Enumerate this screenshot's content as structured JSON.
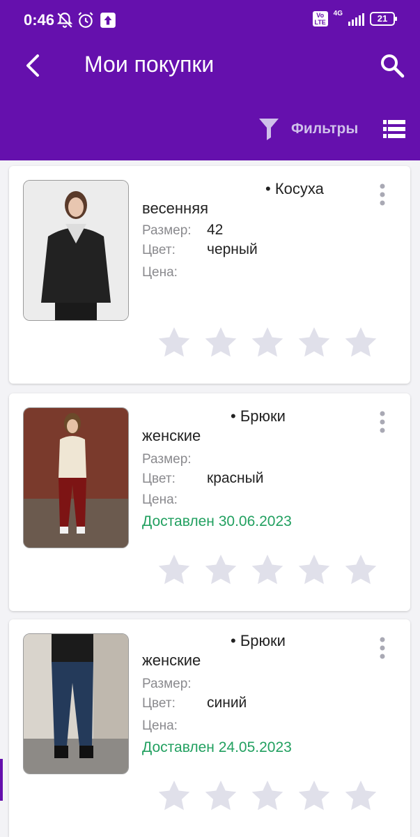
{
  "status_bar": {
    "time": "0:46",
    "network": "4G",
    "volte": "Vo LTE",
    "battery": "21"
  },
  "header": {
    "title": "Мои покупки",
    "filter_label": "Фильтры"
  },
  "labels": {
    "size": "Размер:",
    "color": "Цвет:",
    "price": "Цена:"
  },
  "colors": {
    "brand": "#6510ad",
    "delivered": "#22a060",
    "star": "#e0e0ea"
  },
  "items": [
    {
      "name_line1": "• Косуха",
      "name_line2": "весенняя",
      "size": "42",
      "color": "черный",
      "price": "",
      "delivered": "",
      "rating": 0
    },
    {
      "name_line1": "• Брюки",
      "name_line2": "женские",
      "size": "",
      "color": "красный",
      "price": "",
      "delivered": "Доставлен 30.06.2023",
      "rating": 0
    },
    {
      "name_line1": "• Брюки",
      "name_line2": "женские",
      "size": "",
      "color": "синий",
      "price": "",
      "delivered": "Доставлен 24.05.2023",
      "rating": 0
    }
  ]
}
